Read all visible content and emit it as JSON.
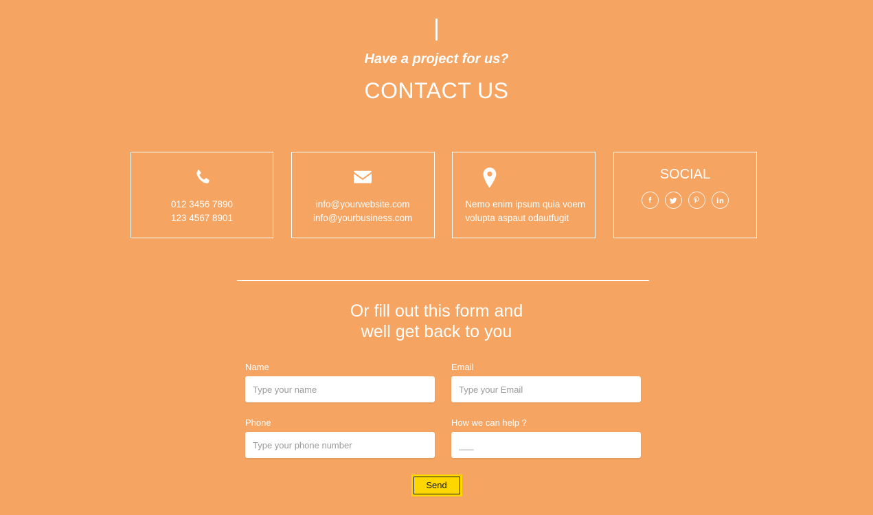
{
  "theme": {
    "background": "#f5a461",
    "text": "#ffffff",
    "accent_button": "#ffd700",
    "button_text": "#111111",
    "input_background": "#ffffff",
    "placeholder": "#9a9a9a"
  },
  "header": {
    "pipe_mark": "|",
    "eyebrow": "Have a project for us?",
    "headline": "CONTACT US"
  },
  "cards": [
    {
      "name": "phone",
      "icon": "phone-icon",
      "lines": [
        "012 3456 7890",
        "123 4567 8901"
      ]
    },
    {
      "name": "email",
      "icon": "envelope-icon",
      "lines": [
        "info@yourwebsite.com",
        "info@yourbusiness.com"
      ]
    },
    {
      "name": "address",
      "icon": "map-pin-icon",
      "lines": [
        "Nemo enim ipsum quia voem",
        "volupta aspaut odautfugit"
      ]
    }
  ],
  "social": {
    "title": "SOCIAL",
    "items": [
      {
        "name": "facebook",
        "icon": "facebook-icon"
      },
      {
        "name": "twitter",
        "icon": "twitter-icon"
      },
      {
        "name": "pinterest",
        "icon": "pinterest-icon"
      },
      {
        "name": "linkedin",
        "icon": "linkedin-icon"
      }
    ]
  },
  "form": {
    "heading_line1": "Or fill out this form and",
    "heading_line2": "well get back to you",
    "fields": {
      "name": {
        "label": "Name",
        "value": "",
        "placeholder": "Type your name"
      },
      "email": {
        "label": "Email",
        "value": "",
        "placeholder": "Type your Email"
      },
      "phone": {
        "label": "Phone",
        "value": "",
        "placeholder": "Type your phone number"
      },
      "help": {
        "label": "How we can help ?",
        "value": "",
        "placeholder": "___"
      }
    },
    "submit_label": "Send"
  }
}
